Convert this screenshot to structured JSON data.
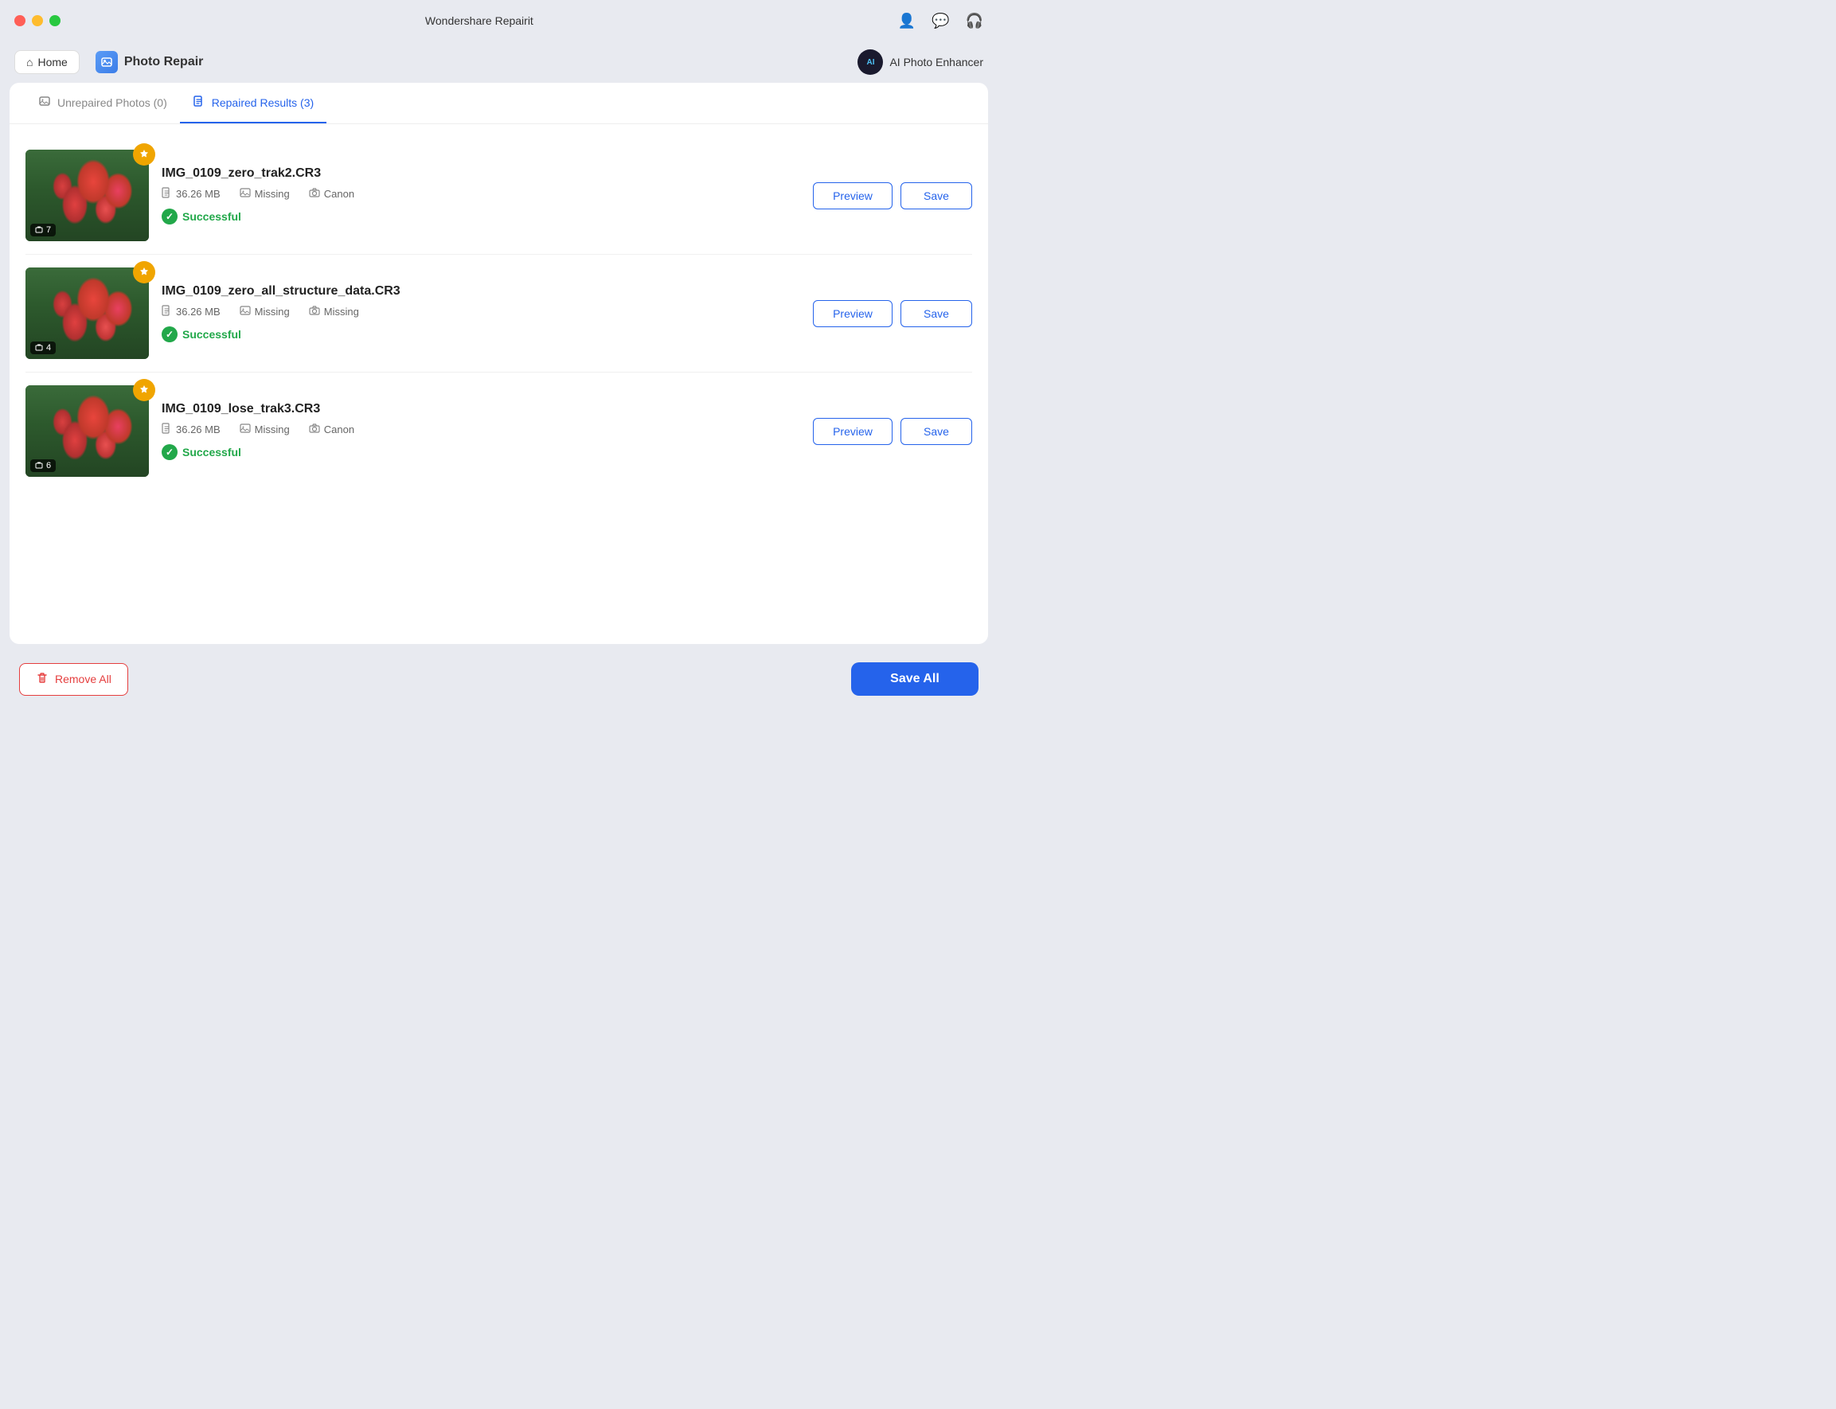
{
  "app": {
    "title": "Wondershare Repairit"
  },
  "titlebar": {
    "buttons": [
      "close",
      "minimize",
      "maximize"
    ],
    "icons": [
      "user",
      "chat",
      "headphone"
    ]
  },
  "navbar": {
    "home_label": "Home",
    "photo_repair_label": "Photo Repair",
    "ai_enhancer_label": "AI Photo Enhancer"
  },
  "tabs": [
    {
      "id": "unrepaired",
      "label": "Unrepaired Photos (0)",
      "active": false
    },
    {
      "id": "repaired",
      "label": "Repaired Results (3)",
      "active": true
    }
  ],
  "photos": [
    {
      "id": 1,
      "name": "IMG_0109_zero_trak2.CR3",
      "size": "36.26 MB",
      "field2": "Missing",
      "field3": "Canon",
      "status": "Successful",
      "count": "7"
    },
    {
      "id": 2,
      "name": "IMG_0109_zero_all_structure_data.CR3",
      "size": "36.26 MB",
      "field2": "Missing",
      "field3": "Missing",
      "status": "Successful",
      "count": "4"
    },
    {
      "id": 3,
      "name": "IMG_0109_lose_trak3.CR3",
      "size": "36.26 MB",
      "field2": "Missing",
      "field3": "Canon",
      "status": "Successful",
      "count": "6"
    }
  ],
  "actions": {
    "preview_label": "Preview",
    "save_label": "Save",
    "remove_all_label": "Remove All",
    "save_all_label": "Save All"
  }
}
